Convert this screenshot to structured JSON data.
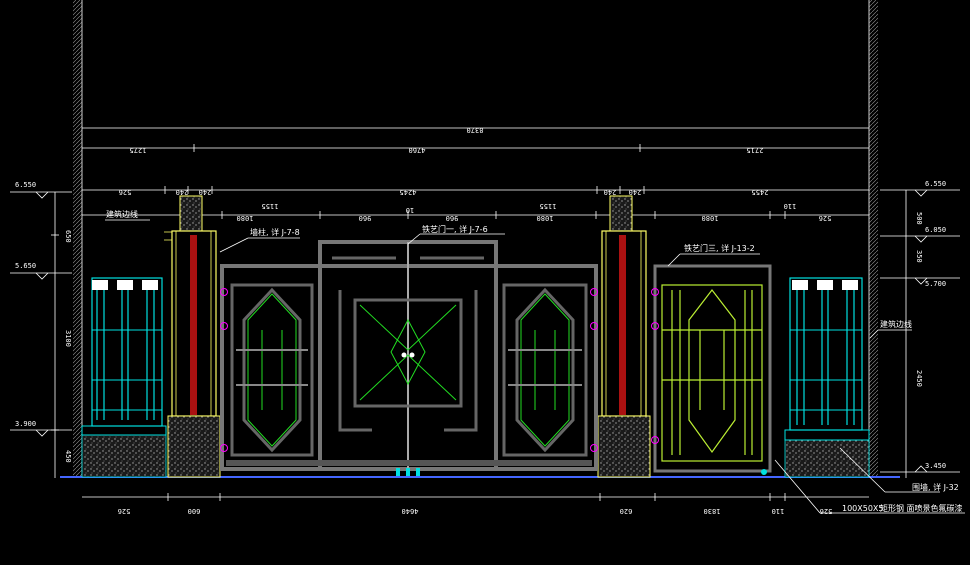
{
  "drawing": {
    "overall_dimension": "8370",
    "segment_dims": [
      "1275",
      "4760",
      "2715"
    ],
    "upper_dims": [
      "526",
      "240",
      "240",
      "4245",
      "240",
      "240",
      "2455"
    ],
    "gate_dims": [
      "1155",
      "1080",
      "960",
      "10",
      "960",
      "1080",
      "1155",
      "1080",
      "110",
      "526"
    ],
    "bottom_dims": [
      "526",
      "600",
      "4640",
      "620",
      "1830",
      "110",
      "526"
    ],
    "elevations": {
      "left": [
        "6.550",
        "5.650",
        "3.900"
      ],
      "right": [
        "6.550",
        "6.050",
        "5.700",
        "3.450"
      ]
    },
    "left_heights": [
      "650",
      "3100",
      "450"
    ],
    "right_heights": [
      "500",
      "350",
      "2450"
    ],
    "annotations": {
      "building_line_left": "建筑边线",
      "building_line_right": "建筑边线",
      "wall_column": "墙柱, 详 J-7-8",
      "gate_one": "铁艺门一, 详 J-7-6",
      "gate_three": "铁艺门三, 详 J-13-2",
      "fence_wall": "围墙, 详 J-32",
      "steel_section": "100X50X5",
      "steel_note": "矩形钢 面喷景色氟碳漆"
    },
    "colors": {
      "background": "#000000",
      "dimension": "#ffffff",
      "wall": "#00e0e0",
      "pillar": "#ffff66",
      "gate_green": "#22dd22",
      "yellow_green": "#bbee33",
      "metal": "#888888",
      "marker": "#ff00ff"
    }
  }
}
